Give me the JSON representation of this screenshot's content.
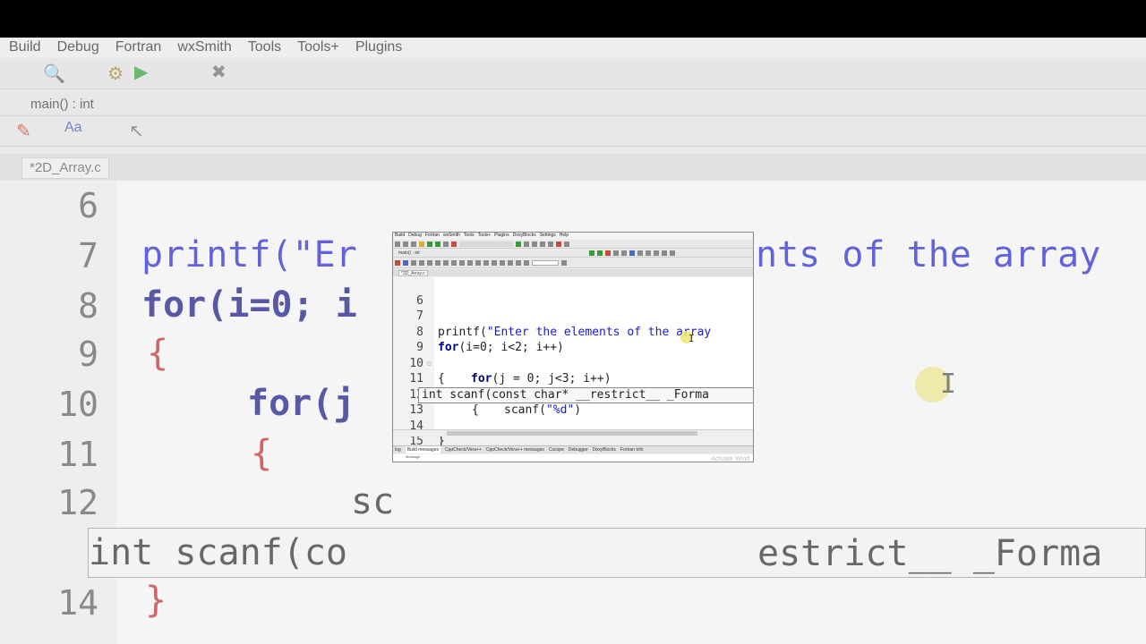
{
  "menu": [
    "Build",
    "Debug",
    "Fortran",
    "wxSmith",
    "Tools",
    "Tools+",
    "Plugins",
    "DoxyBlocks",
    "Settings",
    "Help"
  ],
  "scope": "main() : int",
  "tab": {
    "label": "*2D_Array.c"
  },
  "code_lines": [
    {
      "n": "6"
    },
    {
      "n": "7"
    },
    {
      "n": "8"
    },
    {
      "n": "9"
    },
    {
      "n": "10"
    },
    {
      "n": "11"
    },
    {
      "n": "12"
    },
    {
      "n": "13"
    },
    {
      "n": "14"
    },
    {
      "n": "15"
    }
  ],
  "code": {
    "l7_fn": "printf(",
    "l7_str": "\"Enter the elements of the array",
    "l8_kw": "for",
    "l8_rest": "(i=0; i<2; i++)",
    "l9": "{",
    "l10_kw": "for",
    "l10_rest": "(j = 0; j<3; i++)",
    "l11": "{",
    "l12_fn": "scanf(",
    "l12_str": "\"%d\"",
    "l12_end": ")",
    "l14": "}"
  },
  "calltip": "int scanf(const char* __restrict__ _Forma",
  "bg_code": {
    "l7": "printf(\"Er",
    "l7_right": "nts of the array",
    "l8": "for(i=0; i",
    "l9": "{",
    "l10": "for(j",
    "l11": "{",
    "l12": "sc",
    "l13_left": "int scanf(co",
    "l13_right": "estrict__ _Forma",
    "l14": "}"
  },
  "log_tabs": [
    "log",
    "Build messages",
    "CppCheck/Vera++",
    "CppCheck/Vera++ messages",
    "Cscope",
    "Debugger",
    "DoxyBlocks",
    "Fortran info"
  ],
  "log_active": "Build messages",
  "log_columns": "Message",
  "watermark": "Activate Wind"
}
